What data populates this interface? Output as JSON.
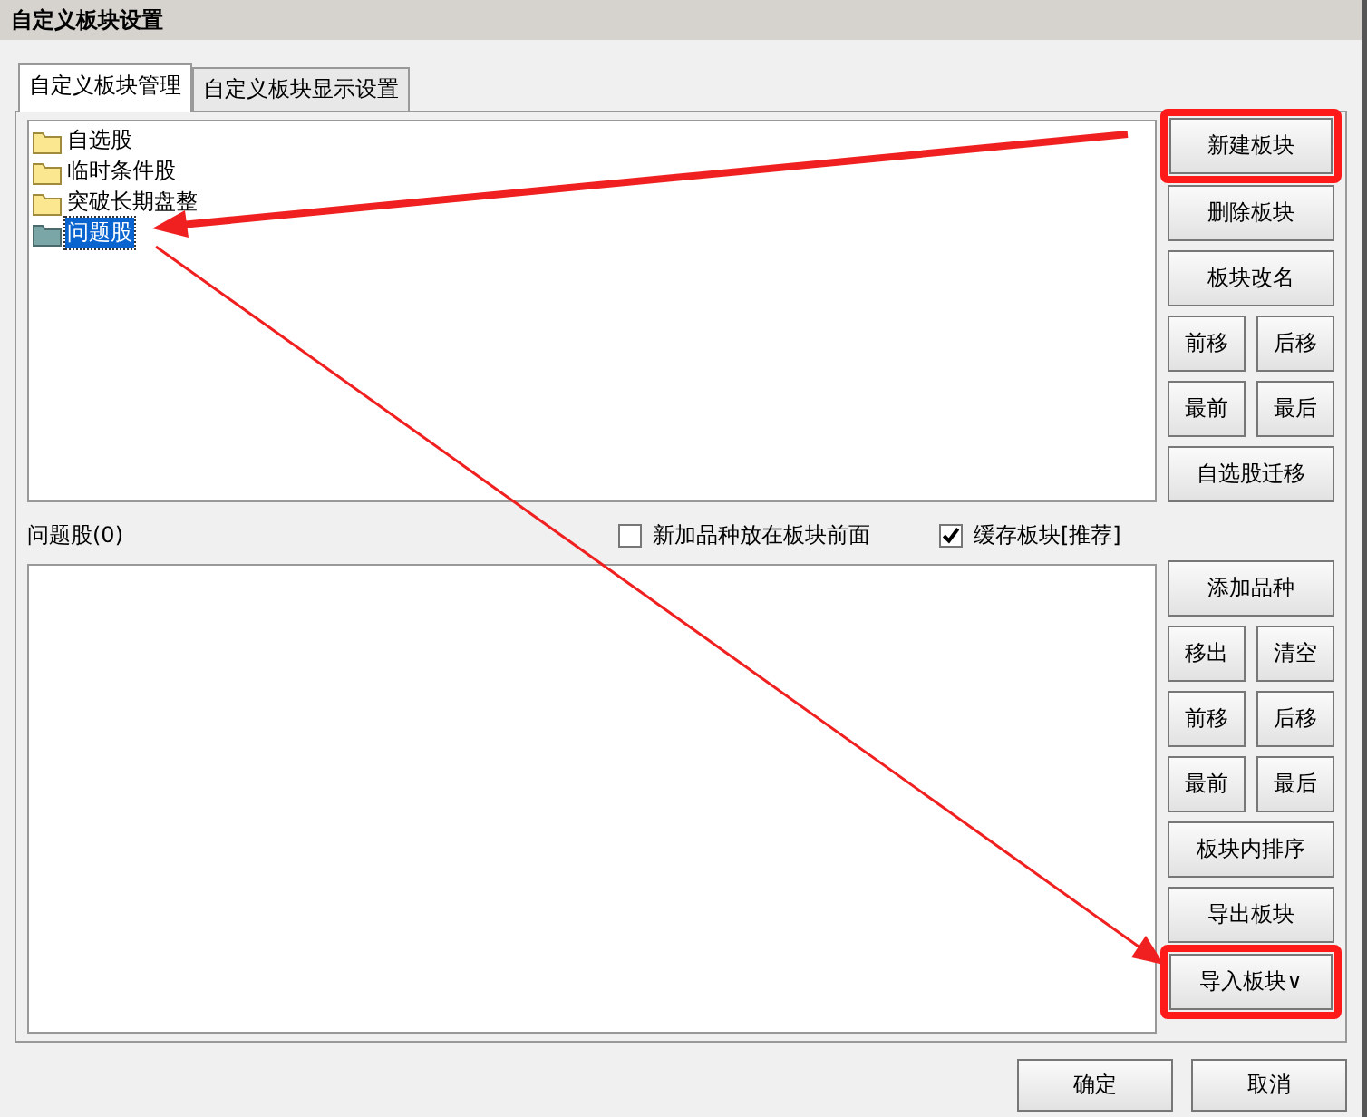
{
  "window": {
    "title": "自定义板块设置"
  },
  "tabs": [
    {
      "label": "自定义板块管理",
      "selected": true
    },
    {
      "label": "自定义板块显示设置",
      "selected": false
    }
  ],
  "block_list": [
    {
      "label": "自选股",
      "selected": false
    },
    {
      "label": "临时条件股",
      "selected": false
    },
    {
      "label": "突破长期盘整",
      "selected": false
    },
    {
      "label": "问题股",
      "selected": true
    }
  ],
  "block_buttons": [
    [
      {
        "label": "新建板块",
        "highlighted": true
      }
    ],
    [
      {
        "label": "删除板块",
        "highlighted": false
      }
    ],
    [
      {
        "label": "板块改名",
        "highlighted": false
      }
    ],
    [
      {
        "label": "前移",
        "highlighted": false
      },
      {
        "label": "后移",
        "highlighted": false
      }
    ],
    [
      {
        "label": "最前",
        "highlighted": false
      },
      {
        "label": "最后",
        "highlighted": false
      }
    ],
    [
      {
        "label": "自选股迁移",
        "highlighted": false
      }
    ]
  ],
  "stock_list_label": "问题股(0)",
  "options": [
    {
      "label": "新加品种放在板块前面",
      "checked": false
    },
    {
      "label": "缓存板块[推荐]",
      "checked": true
    }
  ],
  "stock_buttons": [
    [
      {
        "label": "添加品种",
        "highlighted": false
      }
    ],
    [
      {
        "label": "移出",
        "highlighted": false
      },
      {
        "label": "清空",
        "highlighted": false
      }
    ],
    [
      {
        "label": "前移",
        "highlighted": false
      },
      {
        "label": "后移",
        "highlighted": false
      }
    ],
    [
      {
        "label": "最前",
        "highlighted": false
      },
      {
        "label": "最后",
        "highlighted": false
      }
    ],
    [
      {
        "label": "板块内排序",
        "highlighted": false
      }
    ],
    [
      {
        "label": "导出板块",
        "highlighted": false
      }
    ],
    [
      {
        "label": "导入板块∨",
        "highlighted": true
      }
    ]
  ],
  "dialog_buttons": [
    "确定",
    "取消"
  ]
}
